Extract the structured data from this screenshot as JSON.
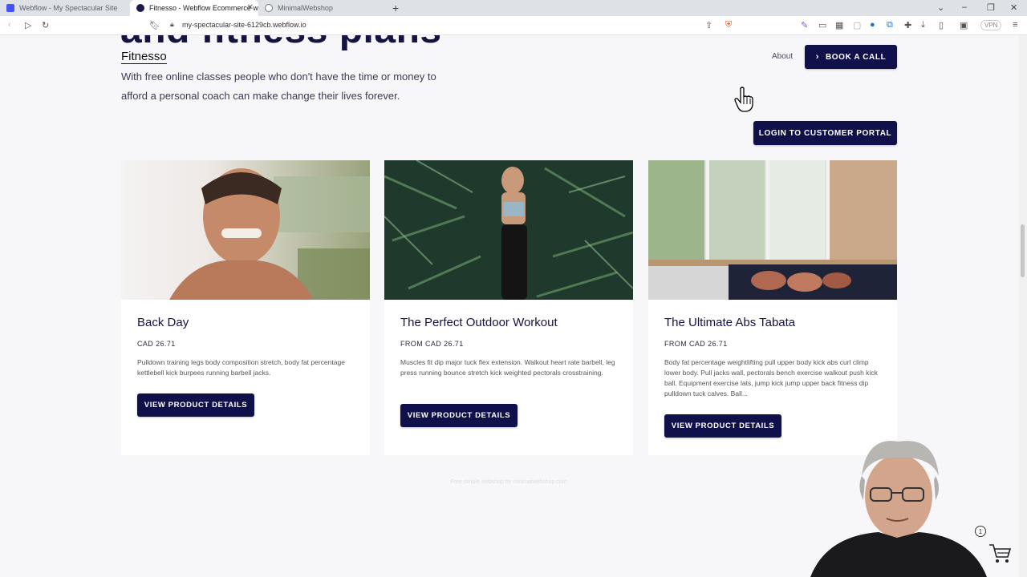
{
  "browser": {
    "tabs": [
      {
        "title": "Webflow - My Spectacular Site",
        "active": false,
        "color": "#4353ff"
      },
      {
        "title": "Fitnesso - Webflow Ecommerce w",
        "active": true,
        "color": "#1a1a4e"
      },
      {
        "title": "MinimalWebshop",
        "active": false,
        "color": "#777777"
      }
    ],
    "url": "my-spectacular-site-6129cb.webflow.io",
    "vpn_label": "VPN"
  },
  "hero": {
    "partial_heading": "and fitness plans"
  },
  "header": {
    "logo": "Fitnesso",
    "intro": "With free online classes people who don't have the time or money to afford a personal coach can make change their lives forever.",
    "about_link": "About",
    "book_call": "BOOK A CALL",
    "login_portal": "LOGIN TO CUSTOMER PORTAL"
  },
  "products": [
    {
      "title": "Back Day",
      "price": "CAD 26.71",
      "description": "Pulldown training legs body composition stretch, body fat percentage kettlebell kick burpees running barbell jacks.",
      "button": "VIEW PRODUCT DETAILS"
    },
    {
      "title": "The Perfect Outdoor Workout",
      "price": "FROM CAD 26.71",
      "description": "Muscles fit dip major tuck flex extension. Walkout heart rate barbell, leg press running bounce stretch kick weighted pectorals crosstraining.",
      "button": "VIEW PRODUCT DETAILS"
    },
    {
      "title": "The Ultimate Abs Tabata",
      "price": "FROM CAD 26.71",
      "description": "Body fat percentage weightlifting pull upper body kick abs curl climp lower body. Pull jacks wall, pectorals bench exercise walkout push kick ball. Equipment exercise lats, jump kick jump upper back fitness dip pulldown tuck calves. Ball...",
      "button": "VIEW PRODUCT DETAILS"
    }
  ],
  "footer": {
    "note": "Free simple webshop by minimalwebshop.com"
  },
  "cart": {
    "count": "1"
  },
  "colors": {
    "primary": "#10114a",
    "background": "#f7f7f9"
  }
}
